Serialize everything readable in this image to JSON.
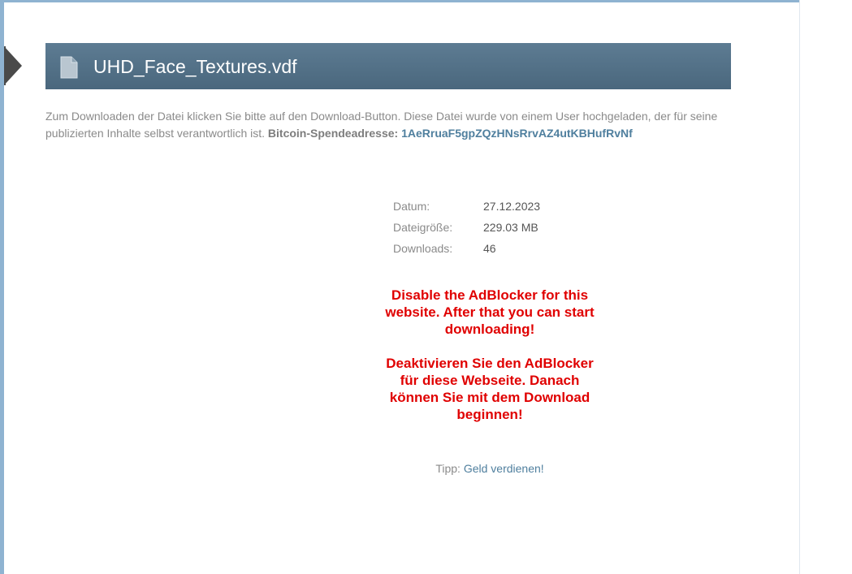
{
  "header": {
    "file_name": "UHD_Face_Textures.vdf",
    "file_icon": "document-icon"
  },
  "intro": {
    "text": "Zum Downloaden der Datei klicken Sie bitte auf den Download-Button. Diese Datei wurde von einem User hochgeladen, der für seine publizierten Inhalte selbst verantwortlich ist.",
    "bitcoin_label": "Bitcoin-Spendeadresse:",
    "bitcoin_address": "1AeRruaF5gpZQzHNsRrvAZ4utKBHufRvNf"
  },
  "info": [
    {
      "label": "Datum:",
      "value": "27.12.2023"
    },
    {
      "label": "Dateigröße:",
      "value": "229.03 MB"
    },
    {
      "label": "Downloads:",
      "value": "46"
    }
  ],
  "warning": {
    "english": "Disable the AdBlocker for this website. After that you can start downloading!",
    "german": "Deaktivieren Sie den AdBlocker für diese Webseite. Danach können Sie mit dem Download beginnen!"
  },
  "tip": {
    "label": "Tipp:",
    "link_text": "Geld verdienen!"
  },
  "colors": {
    "title_bar": "#527086",
    "warning": "#e00000",
    "link": "#4f7f9e",
    "frame_border": "#8fb3d1"
  }
}
